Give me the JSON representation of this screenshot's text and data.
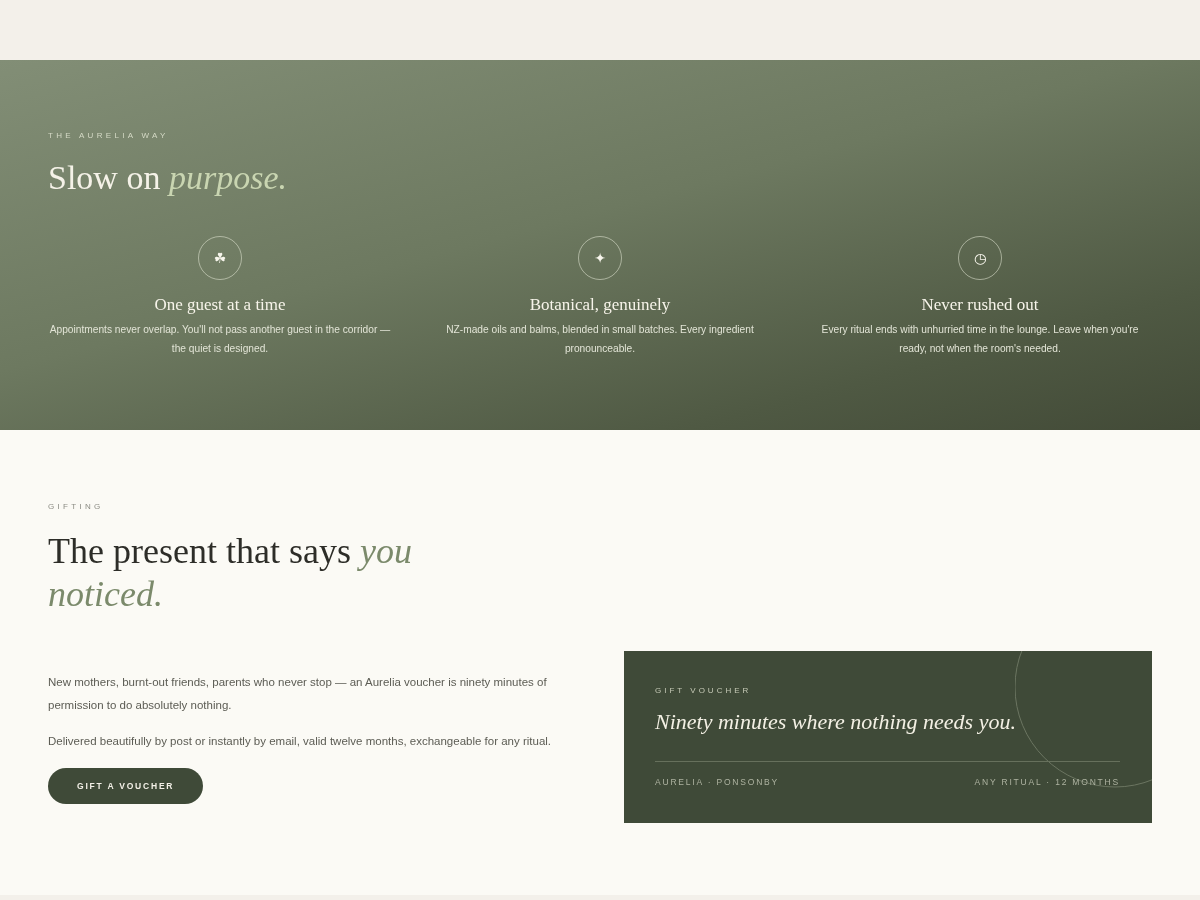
{
  "hero": {
    "eyebrow": "THE AURELIA WAY",
    "title": "Slow on *purpose.*",
    "features": [
      {
        "glyph": "☘",
        "title": "One guest at a time",
        "text": "Appointments never overlap. You'll not pass another guest in the corridor — the quiet is designed."
      },
      {
        "glyph": "✦",
        "title": "Botanical, genuinely",
        "text": "NZ-made oils and balms, blended in small batches. Every ingredient pronounceable."
      },
      {
        "glyph": "◷",
        "title": "Never rushed out",
        "text": "Every ritual ends with unhurried time in the lounge. Leave when you're ready, not when the room's needed."
      }
    ]
  },
  "gifting": {
    "eyebrow": "GIFTING",
    "title": "The present that says *you noticed.*",
    "paragraphs": [
      "New mothers, burnt-out friends, parents who never stop — an Aurelia voucher is ninety minutes of permission to do absolutely nothing.",
      "Delivered beautifully by post or instantly by email, valid twelve months, exchangeable for any ritual."
    ],
    "button": "GIFT A VOUCHER",
    "voucher": {
      "eyebrow": "GIFT VOUCHER",
      "quote": "Ninety minutes where nothing needs you.",
      "footer_left": "AURELIA · PONSONBY",
      "footer_right": "ANY RITUAL · 12 MONTHS"
    }
  }
}
